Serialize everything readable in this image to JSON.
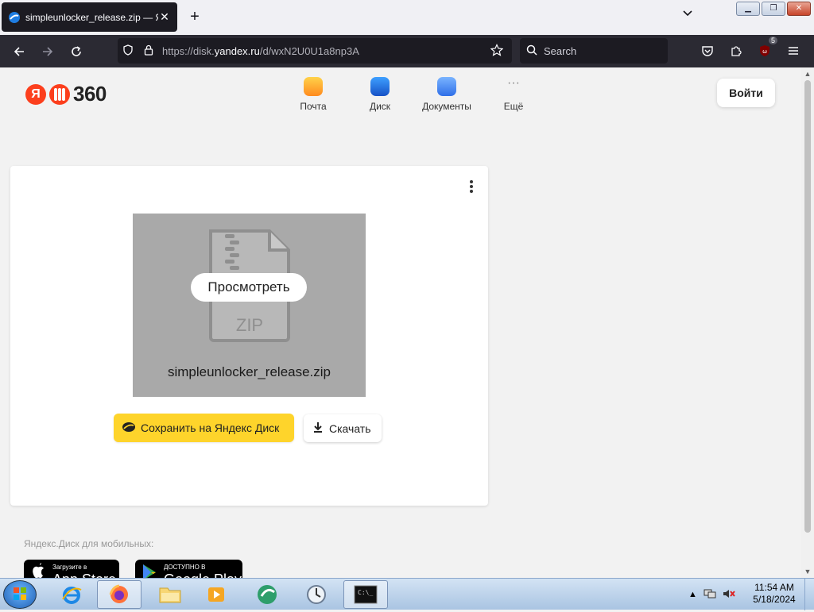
{
  "browser": {
    "tab_title": "simpleunlocker_release.zip — Я",
    "tab_close": "✕",
    "new_tab": "+",
    "url_host": "https://disk.",
    "url_domain": "yandex.ru",
    "url_path": "/d/wxN2U0U1a8np3A",
    "search_placeholder": "Search",
    "extension_badge": "5"
  },
  "header": {
    "logo_num": "360",
    "services": [
      {
        "label": "Почта",
        "color": "#ffb422"
      },
      {
        "label": "Диск",
        "color": "#1f7de1"
      },
      {
        "label": "Документы",
        "color": "#3d8cf3"
      },
      {
        "label": "Ещё",
        "more": "···"
      }
    ],
    "login_label": "Войти"
  },
  "file_card": {
    "preview_button": "Просмотреть",
    "zip_label": "ZIP",
    "file_name": "simpleunlocker_release.zip",
    "save_button": "Сохранить на Яндекс Диск",
    "download_button": "Скачать"
  },
  "footer": {
    "mobile_label": "Яндекс.Диск для мобильных:",
    "app_store_small": "Загрузите в",
    "app_store_big": "App Store",
    "google_play_small": "ДОСТУПНО В",
    "google_play_big": "Google Play"
  },
  "taskbar": {
    "clock_time": "11:54 AM",
    "clock_date": "5/18/2024"
  }
}
